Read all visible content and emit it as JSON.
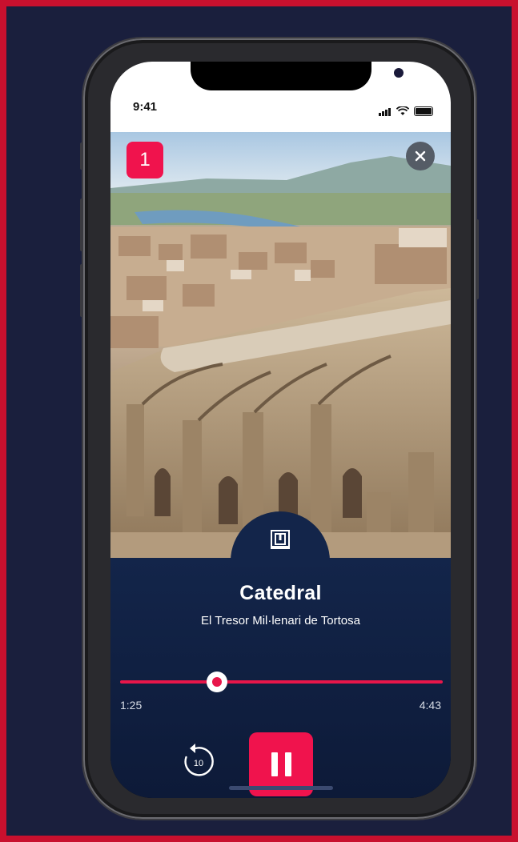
{
  "status_bar": {
    "time": "9:41"
  },
  "stop": {
    "number": "1"
  },
  "audio": {
    "title": "Catedral",
    "subtitle": "El Tresor Mil·lenari de Tortosa",
    "current_time": "1:25",
    "total_time": "4:43",
    "progress_fraction": 0.3,
    "rewind_seconds": "10"
  },
  "icons": {
    "close": "close-icon",
    "museum": "museum-icon",
    "rewind": "rewind-10-icon",
    "pause": "pause-icon"
  },
  "colors": {
    "accent": "#f0134d",
    "player_bg": "#13254a",
    "frame": "#c8102e",
    "background": "#1a1f3d"
  }
}
